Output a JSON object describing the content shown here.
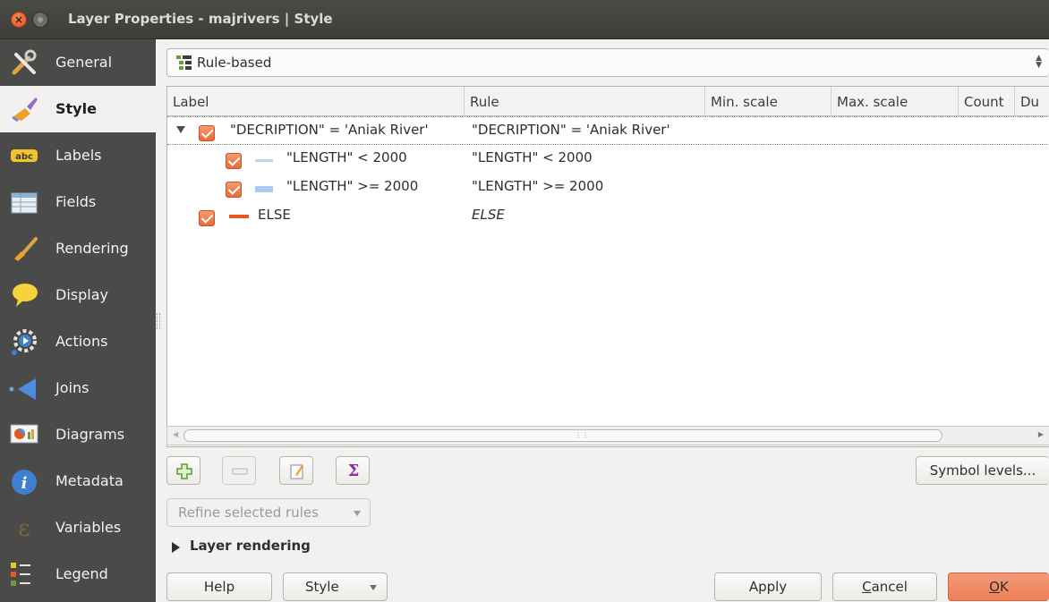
{
  "window": {
    "title": "Layer Properties - majrivers | Style"
  },
  "sidebar": {
    "items": [
      {
        "label": "General",
        "icon": "tools-icon"
      },
      {
        "label": "Style",
        "icon": "brush-icon",
        "selected": true
      },
      {
        "label": "Labels",
        "icon": "abc-label-icon"
      },
      {
        "label": "Fields",
        "icon": "table-icon"
      },
      {
        "label": "Rendering",
        "icon": "paintbrush-icon"
      },
      {
        "label": "Display",
        "icon": "speech-bubble-icon"
      },
      {
        "label": "Actions",
        "icon": "gear-play-icon"
      },
      {
        "label": "Joins",
        "icon": "joins-arrow-icon"
      },
      {
        "label": "Diagrams",
        "icon": "diagram-icon"
      },
      {
        "label": "Metadata",
        "icon": "info-icon"
      },
      {
        "label": "Variables",
        "icon": "epsilon-icon"
      },
      {
        "label": "Legend",
        "icon": "legend-icon"
      }
    ]
  },
  "renderer": {
    "selected": "Rule-based"
  },
  "rules_table": {
    "columns": [
      "Label",
      "Rule",
      "Min. scale",
      "Max. scale",
      "Count",
      "Du"
    ],
    "rows": [
      {
        "label": "\"DECRIPTION\" = 'Aniak River'",
        "rule": "\"DECRIPTION\" = 'Aniak River'",
        "level": 0,
        "expanded": true,
        "checked": true,
        "symbol_color": ""
      },
      {
        "label": "\"LENGTH\" < 2000",
        "rule": "\"LENGTH\" < 2000",
        "level": 1,
        "checked": true,
        "symbol_color": "#bcd4ee"
      },
      {
        "label": "\"LENGTH\" >= 2000",
        "rule": "\"LENGTH\" >= 2000",
        "level": 1,
        "checked": true,
        "symbol_color": "#a9ccf0"
      },
      {
        "label": "ELSE",
        "rule": "ELSE",
        "level": 0,
        "checked": true,
        "symbol_color": "#e8581c",
        "italic_rule": true
      }
    ]
  },
  "toolbar": {
    "add_icon": "add-rule-icon",
    "remove_icon": "remove-rule-icon",
    "edit_icon": "edit-rule-icon",
    "sigma_icon": "sigma-icon",
    "sigma_glyph": "Σ",
    "symbol_levels_label": "Symbol levels..."
  },
  "refine": {
    "label": "Refine selected rules"
  },
  "layer_rendering": {
    "label": "Layer rendering"
  },
  "buttons": {
    "help": "Help",
    "style": "Style",
    "apply": "Apply",
    "cancel_u": "C",
    "cancel_rest": "ancel",
    "ok_u": "O",
    "ok_rest": "K"
  },
  "colors": {
    "accent": "#ee7f56",
    "sidebar_bg": "#4a4a48",
    "titlebar_bg": "#3f3f3b"
  }
}
